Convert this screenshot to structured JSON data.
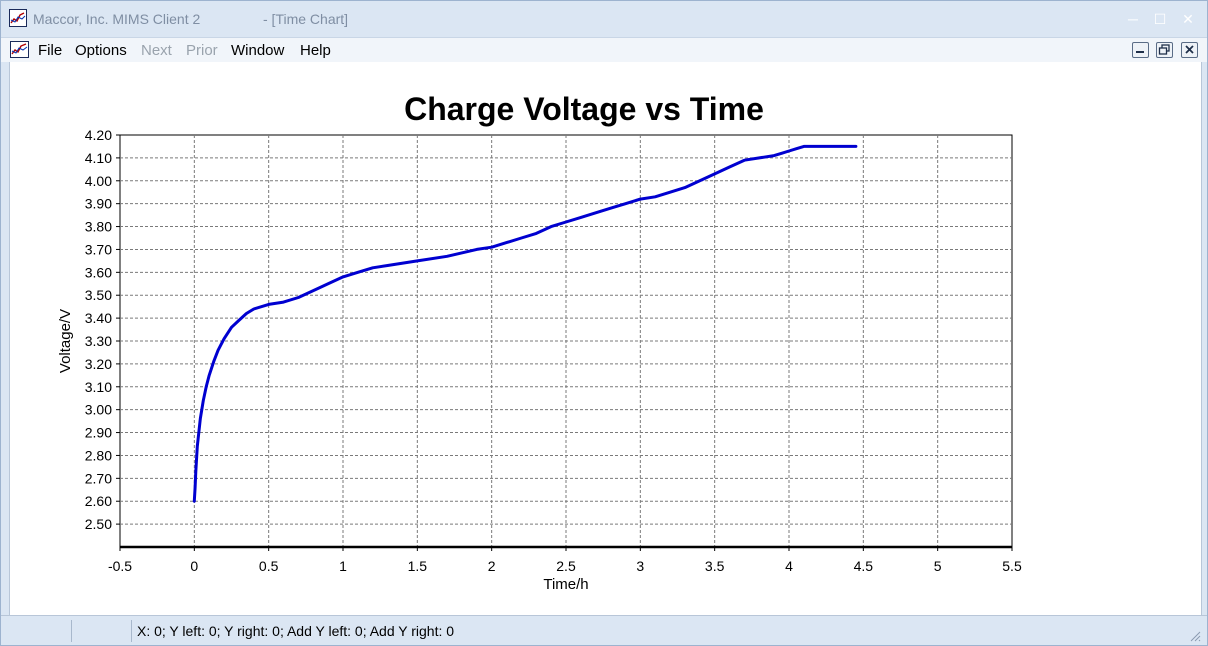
{
  "window": {
    "app_title": "Maccor, Inc. MIMS Client 2",
    "doc_title": "- [Time Chart]",
    "controls": {
      "minimize": "─",
      "maximize": "☐",
      "close": "✕"
    }
  },
  "menu": {
    "file": "File",
    "options": "Options",
    "next": "Next",
    "prior": "Prior",
    "window": "Window",
    "help": "Help"
  },
  "status": {
    "text": "X: 0; Y left: 0; Y right: 0; Add Y left: 0; Add Y right: 0"
  },
  "colors": {
    "series": "#0000d0",
    "grid": "#7a7a7a",
    "title_bar": "#dbe6f3",
    "disabled_text": "#9aa3ad"
  },
  "chart_data": {
    "type": "line",
    "title": "Charge Voltage vs Time",
    "xlabel": "Time/h",
    "ylabel": "Voltage/V",
    "xlim": [
      -0.5,
      5.5
    ],
    "ylim": [
      2.4,
      4.2
    ],
    "x_ticks": [
      "-0.5",
      "0",
      "0.5",
      "1",
      "1.5",
      "2",
      "2.5",
      "3",
      "3.5",
      "4",
      "4.5",
      "5",
      "5.5"
    ],
    "y_ticks": [
      "4.20",
      "4.10",
      "4.00",
      "3.90",
      "3.80",
      "3.70",
      "3.60",
      "3.50",
      "3.40",
      "3.30",
      "3.20",
      "3.10",
      "3.00",
      "2.90",
      "2.80",
      "2.70",
      "2.60",
      "2.50"
    ],
    "grid": true,
    "series": [
      {
        "x": [
          0.0,
          0.005,
          0.01,
          0.02,
          0.04,
          0.06,
          0.08,
          0.1,
          0.13,
          0.16,
          0.2,
          0.25,
          0.3,
          0.35,
          0.4,
          0.5,
          0.6,
          0.7,
          0.8,
          0.9,
          1.0,
          1.1,
          1.2,
          1.3,
          1.5,
          1.7,
          1.9,
          2.0,
          2.1,
          2.2,
          2.3,
          2.4,
          2.5,
          2.6,
          2.7,
          2.8,
          2.9,
          3.0,
          3.1,
          3.2,
          3.3,
          3.4,
          3.5,
          3.6,
          3.7,
          3.8,
          3.9,
          3.95,
          4.0,
          4.05,
          4.1,
          4.2,
          4.3,
          4.4,
          4.45
        ],
        "y": [
          2.6,
          2.66,
          2.73,
          2.84,
          2.96,
          3.04,
          3.1,
          3.15,
          3.21,
          3.26,
          3.31,
          3.36,
          3.39,
          3.42,
          3.44,
          3.46,
          3.47,
          3.49,
          3.52,
          3.55,
          3.58,
          3.6,
          3.62,
          3.63,
          3.65,
          3.67,
          3.7,
          3.71,
          3.73,
          3.75,
          3.77,
          3.8,
          3.82,
          3.84,
          3.86,
          3.88,
          3.9,
          3.92,
          3.93,
          3.95,
          3.97,
          4.0,
          4.03,
          4.06,
          4.09,
          4.1,
          4.11,
          4.12,
          4.13,
          4.14,
          4.15,
          4.15,
          4.15,
          4.15,
          4.15
        ]
      }
    ]
  }
}
